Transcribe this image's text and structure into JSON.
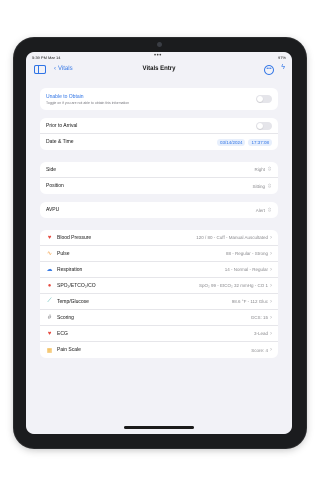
{
  "status_bar": {
    "time": "5:39 PM  Mar 14",
    "dots": "•••",
    "right": "97%"
  },
  "nav": {
    "back_label": "Vitals",
    "title": "Vitals Entry",
    "more_icon": "ellipsis-circle-icon",
    "bolt_icon": "bolt-icon"
  },
  "unable": {
    "label": "Unable to Obtain",
    "hint": "Toggle on if you are not able to obtain this information"
  },
  "prior": {
    "label": "Prior to Arrival"
  },
  "datetime": {
    "label": "Date & Time",
    "date": "03/14/2024",
    "time": "17:37:08"
  },
  "position_block": {
    "side": {
      "label": "Side",
      "value": "Right"
    },
    "position": {
      "label": "Position",
      "value": "Sitting"
    }
  },
  "avpu": {
    "label": "AVPU",
    "value": "Alert"
  },
  "vitals": [
    {
      "label": "Blood Pressure",
      "value": "120 / 80 - Cuff - Manual Auscultated",
      "icon": "heart-icon",
      "color": "#e5483e"
    },
    {
      "label": "Pulse",
      "value": "88 - Regular - Strong",
      "icon": "pulse-icon",
      "color": "#f39a3c"
    },
    {
      "label": "Respiration",
      "value": "14 - Normal - Regular",
      "icon": "lungs-icon",
      "color": "#3d7de3"
    },
    {
      "label": "SPO₂/ETCO₂/CO",
      "value": "SpO₂ 99 - EtCO₂ 32 mmHg - CO 1",
      "icon": "drop-icon",
      "color": "#e5483e"
    },
    {
      "label": "Temp/Glucose",
      "value": "98.6 °F - 112 Gluc",
      "icon": "thermometer-icon",
      "color": "#2ea8a0"
    },
    {
      "label": "Scoring",
      "value": "GCS: 15",
      "icon": "hash-icon",
      "color": "#6b6b70"
    },
    {
      "label": "ECG",
      "value": "3-Lead",
      "icon": "ecg-heart-icon",
      "color": "#e5483e"
    },
    {
      "label": "Pain Scale",
      "value": "Score: 4",
      "icon": "pain-scale-icon",
      "color": "#f0b13a"
    }
  ]
}
